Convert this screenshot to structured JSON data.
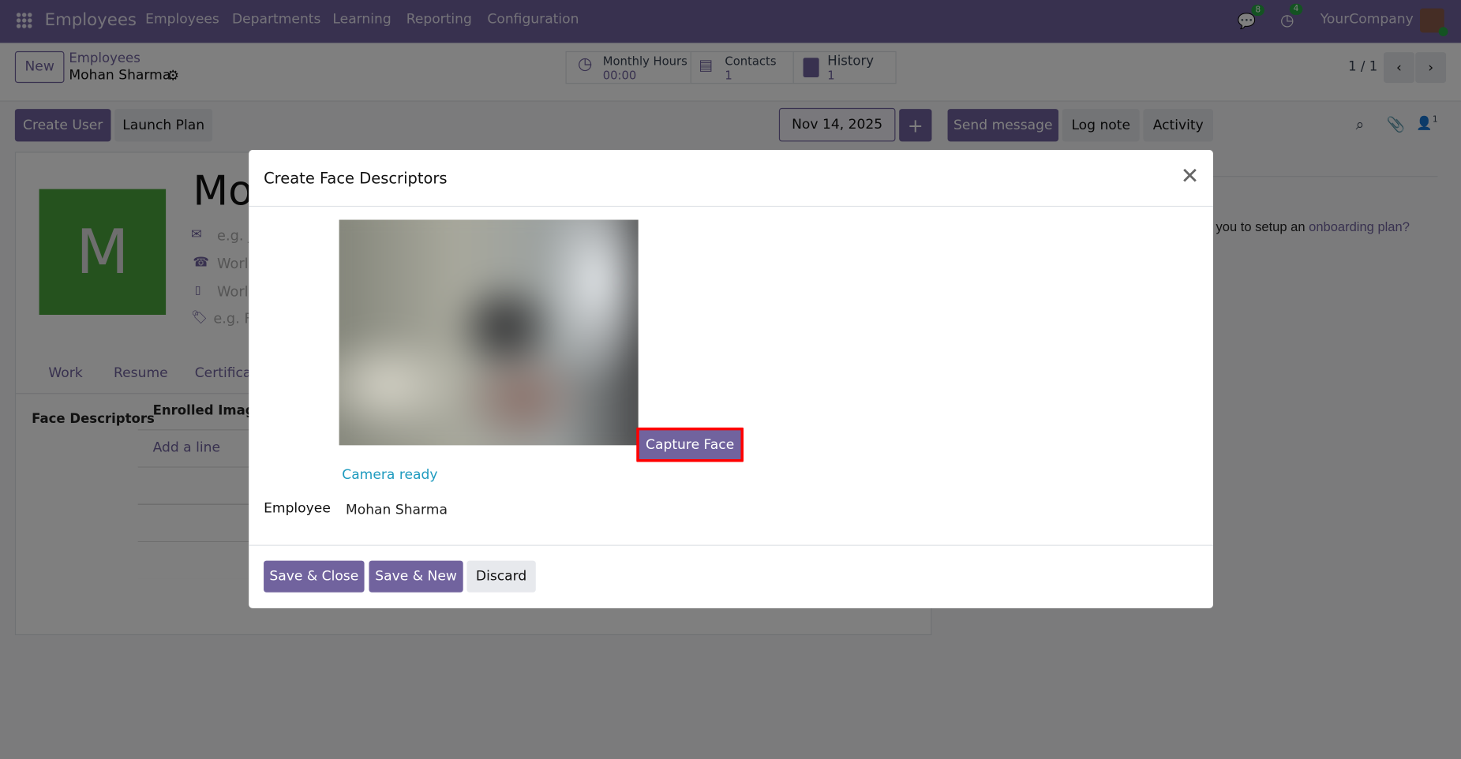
{
  "navbar": {
    "app_title": "Employees",
    "menu": [
      "Employees",
      "Departments",
      "Learning",
      "Reporting",
      "Configuration"
    ],
    "messages_count": "8",
    "activities_count": "4",
    "company": "YourCompany"
  },
  "control_panel": {
    "new_label": "New",
    "breadcrumb_parent": "Employees",
    "breadcrumb_current": "Mohan Sharma",
    "stats": [
      {
        "label": "Monthly Hours",
        "value": "00:00"
      },
      {
        "label": "Contacts",
        "value": "1"
      },
      {
        "label": "History",
        "value": "1"
      }
    ],
    "pager": "1 / 1"
  },
  "actions": {
    "create_user": "Create User",
    "launch_plan": "Launch Plan",
    "date": "Nov 14, 2025",
    "plus": "+",
    "send_message": "Send message",
    "log_note": "Log note",
    "activity": "Activity",
    "followers_count": "1"
  },
  "form": {
    "avatar_letter": "M",
    "name_partial": "Mo",
    "email_placeholder": "e.g. j",
    "phone_placeholder": "Worl",
    "mobile_placeholder": "Worl",
    "tags_placeholder": "e.g. F",
    "tabs": [
      "Work",
      "Resume",
      "Certifica"
    ],
    "section_label": "Face Descriptors",
    "column_header": "Enrolled Image",
    "add_line": "Add a line"
  },
  "chatter": {
    "text": "you to setup an",
    "link": "onboarding plan?"
  },
  "dialog": {
    "title": "Create Face Descriptors",
    "capture_button": "Capture Face",
    "status": "Camera ready",
    "employee_label": "Employee",
    "employee_value": "Mohan Sharma",
    "save_close": "Save & Close",
    "save_new": "Save & New",
    "discard": "Discard"
  },
  "colors": {
    "primary": "#71639e",
    "highlight": "#ff0000",
    "status": "#1f9bbf",
    "avatar": "#4aa43d"
  }
}
